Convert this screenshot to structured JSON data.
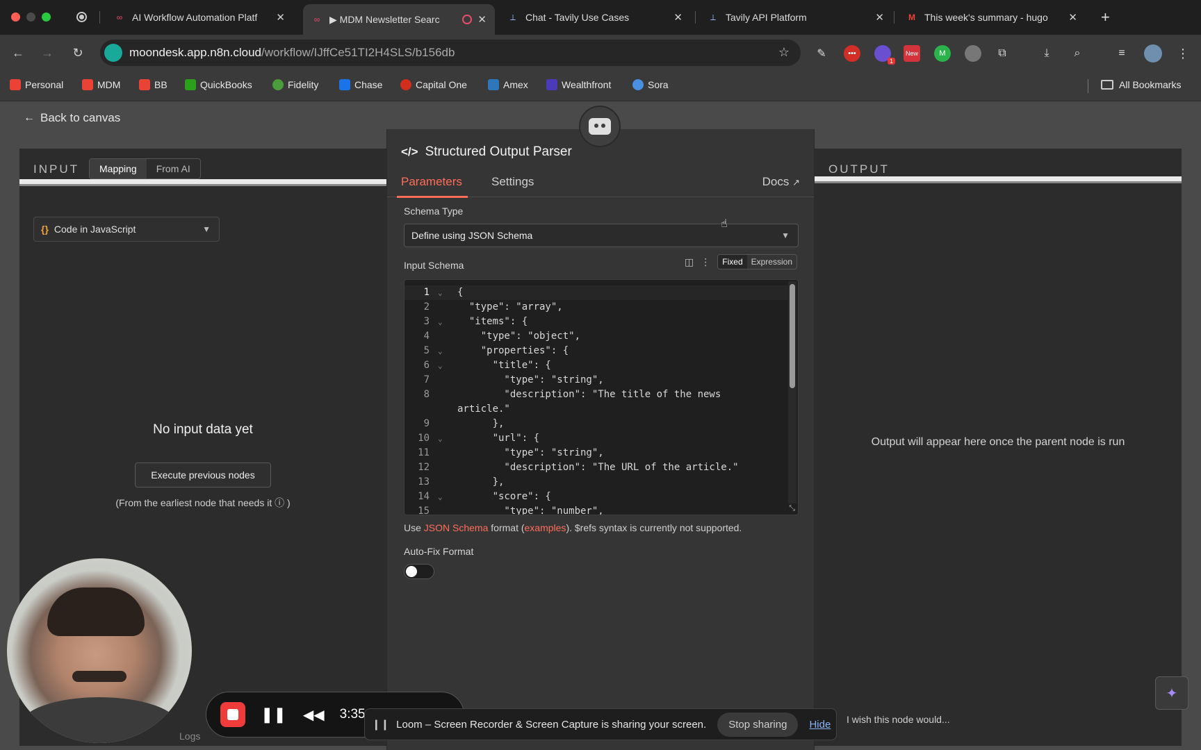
{
  "browser": {
    "tabs": [
      {
        "title": "AI Workflow Automation Platf",
        "active": false
      },
      {
        "title": "▶ MDM Newsletter Searc",
        "active": true
      },
      {
        "title": "Chat - Tavily Use Cases",
        "active": false
      },
      {
        "title": "Tavily API Platform",
        "active": false
      },
      {
        "title": "This week's summary - hugo",
        "active": false
      }
    ],
    "url_host": "moondesk.app.n8n.cloud",
    "url_path": "/workflow/IJffCe51TI2H4SLS/b156db",
    "extension_badges": {
      "notifications": "1",
      "new": "New"
    },
    "bookmarks": [
      "Personal",
      "MDM",
      "BB",
      "QuickBooks",
      "Fidelity",
      "Chase",
      "Capital One",
      "Amex",
      "Wealthfront",
      "Sora"
    ],
    "all_bookmarks": "All Bookmarks"
  },
  "app": {
    "back_label": "Back to canvas",
    "input": {
      "title": "INPUT",
      "mode_mapping": "Mapping",
      "mode_from_ai": "From AI",
      "node_select": "Code in JavaScript",
      "empty_title": "No input data yet",
      "execute_button": "Execute previous nodes",
      "hint": "(From the earliest node that needs it ⓘ )"
    },
    "node": {
      "title": "Structured Output Parser",
      "tab_parameters": "Parameters",
      "tab_settings": "Settings",
      "docs": "Docs",
      "schema_type_label": "Schema Type",
      "schema_type_value": "Define using JSON Schema",
      "input_schema_label": "Input Schema",
      "fixed": "Fixed",
      "expression": "Expression",
      "code_lines": [
        {
          "n": "1",
          "fold": true,
          "text": "{"
        },
        {
          "n": "2",
          "fold": false,
          "text": "  \"type\": \"array\","
        },
        {
          "n": "3",
          "fold": true,
          "text": "  \"items\": {"
        },
        {
          "n": "4",
          "fold": false,
          "text": "    \"type\": \"object\","
        },
        {
          "n": "5",
          "fold": true,
          "text": "    \"properties\": {"
        },
        {
          "n": "6",
          "fold": true,
          "text": "      \"title\": {"
        },
        {
          "n": "7",
          "fold": false,
          "text": "        \"type\": \"string\","
        },
        {
          "n": "8",
          "fold": false,
          "text": "        \"description\": \"The title of the news"
        },
        {
          "n": "",
          "fold": false,
          "text": "article.\""
        },
        {
          "n": "9",
          "fold": false,
          "text": "      },"
        },
        {
          "n": "10",
          "fold": true,
          "text": "      \"url\": {"
        },
        {
          "n": "11",
          "fold": false,
          "text": "        \"type\": \"string\","
        },
        {
          "n": "12",
          "fold": false,
          "text": "        \"description\": \"The URL of the article.\""
        },
        {
          "n": "13",
          "fold": false,
          "text": "      },"
        },
        {
          "n": "14",
          "fold": true,
          "text": "      \"score\": {"
        },
        {
          "n": "15",
          "fold": false,
          "text": "        \"type\": \"number\","
        }
      ],
      "hint_prefix": "Use ",
      "hint_link1": "JSON Schema",
      "hint_mid": " format (",
      "hint_link2": "examples",
      "hint_suffix": "). $refs syntax is currently not supported.",
      "autofix_label": "Auto-Fix Format"
    },
    "output": {
      "title": "OUTPUT",
      "empty_message": "Output will appear here once the parent node is run"
    },
    "feedback_placeholder": "I wish this node would...",
    "logs_label": "Logs"
  },
  "recorder": {
    "time": "3:35",
    "share_message": "Loom – Screen Recorder & Screen Capture is sharing your screen.",
    "stop_sharing": "Stop sharing",
    "hide": "Hide"
  },
  "colors": {
    "accent": "#ff6d5a",
    "record_red": "#f03b3b",
    "link_blue": "#8ab4f8"
  }
}
